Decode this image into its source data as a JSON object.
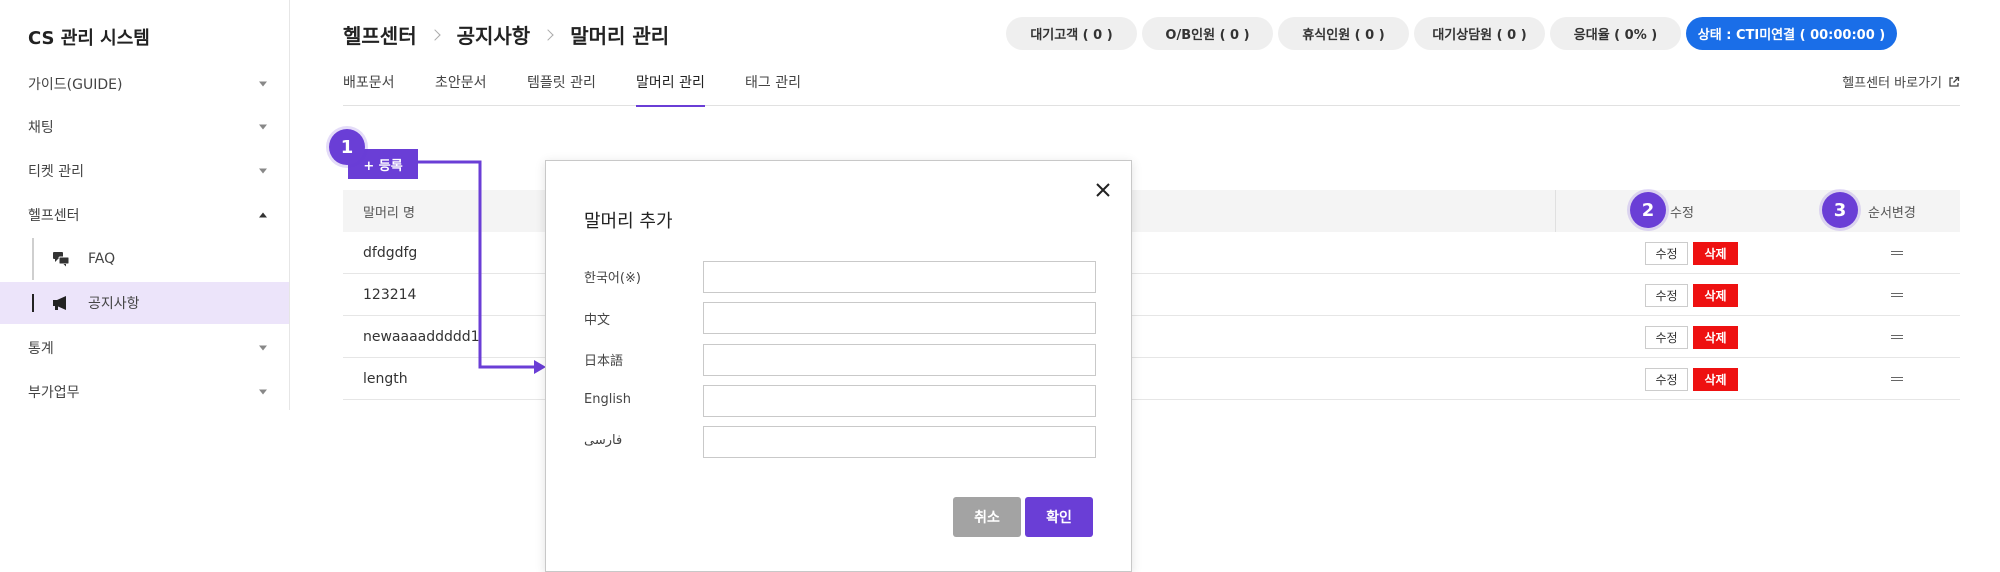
{
  "app": {
    "title": "CS 관리 시스템"
  },
  "sidebar": {
    "items": [
      {
        "label": "가이드(GUIDE)"
      },
      {
        "label": "채팅"
      },
      {
        "label": "티켓 관리"
      },
      {
        "label": "헬프센터"
      },
      {
        "label": "통계"
      },
      {
        "label": "부가업무"
      }
    ],
    "sub_items": [
      {
        "label": "FAQ",
        "icon": "chat-bubbles-icon"
      },
      {
        "label": "공지사항",
        "icon": "megaphone-icon"
      }
    ]
  },
  "breadcrumb": [
    "헬프센터",
    "공지사항",
    "말머리 관리"
  ],
  "stats": [
    {
      "label": "대기고객 ( 0 )"
    },
    {
      "label": "O/B인원 ( 0 )"
    },
    {
      "label": "휴식인원 ( 0 )"
    },
    {
      "label": "대기상담원 ( 0 )"
    },
    {
      "label": "응대율 ( 0% )"
    },
    {
      "label": "상태 : CTI미연결 ( 00:00:00 )",
      "color": "#1a6ee8"
    }
  ],
  "tabs": [
    {
      "label": "배포문서"
    },
    {
      "label": "초안문서"
    },
    {
      "label": "템플릿 관리"
    },
    {
      "label": "말머리 관리",
      "active": true
    },
    {
      "label": "태그 관리"
    }
  ],
  "shortcut": {
    "label": "헬프센터 바로가기"
  },
  "register_button": {
    "label": "+ 등록"
  },
  "table": {
    "headers": {
      "name": "말머리 명",
      "edit": "수정",
      "order": "순서변경"
    },
    "rows": [
      {
        "name": "dfdgdfg"
      },
      {
        "name": "123214"
      },
      {
        "name": "newaaaaddddd1"
      },
      {
        "name": "length"
      }
    ],
    "edit_label": "수정",
    "delete_label": "삭제"
  },
  "markers": [
    "1",
    "2",
    "3"
  ],
  "modal": {
    "title": "말머리 추가",
    "fields": [
      {
        "label": "한국어(※)",
        "value": ""
      },
      {
        "label": "中文",
        "value": ""
      },
      {
        "label": "日本語",
        "value": ""
      },
      {
        "label": "English",
        "value": ""
      },
      {
        "label": "فارسی",
        "value": ""
      }
    ],
    "cancel_label": "취소",
    "ok_label": "확인"
  },
  "colors": {
    "accent": "#6a3ed6",
    "delete": "#ee1111",
    "cti": "#1a6ee8"
  }
}
